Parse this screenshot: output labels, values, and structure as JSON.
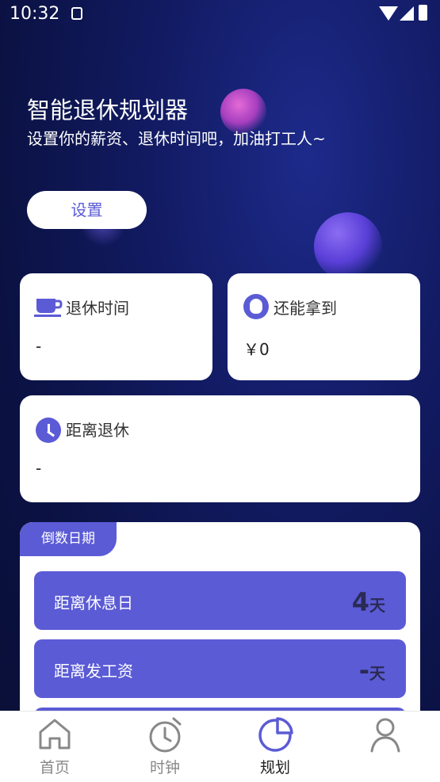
{
  "status_bar": {
    "time": "10:32"
  },
  "header": {
    "title": "智能退休规划器",
    "subtitle": "设置你的薪资、退休时间吧，加油打工人~",
    "settings_button": "设置"
  },
  "cards": {
    "retire_time": {
      "label": "退休时间",
      "value": "-",
      "icon": "coffee-cup-icon"
    },
    "still_get": {
      "label": "还能拿到",
      "value": "￥0",
      "icon": "money-bag-icon"
    },
    "until_retire": {
      "label": "距离退休",
      "value": "-",
      "icon": "clock-icon"
    }
  },
  "countdown": {
    "tag": "倒数日期",
    "items": [
      {
        "label": "距离休息日",
        "value": "4",
        "unit": "天"
      },
      {
        "label": "距离发工资",
        "value": "-",
        "unit": "天"
      }
    ]
  },
  "tabbar": {
    "active": "规划",
    "tabs": [
      {
        "label": "首页",
        "icon": "home-icon"
      },
      {
        "label": "时钟",
        "icon": "alarm-clock-icon"
      },
      {
        "label": "规划",
        "icon": "pie-chart-icon"
      },
      {
        "label": "",
        "icon": "user-icon"
      }
    ]
  },
  "colors": {
    "accent": "#5b5bd6",
    "background": "#121b63"
  }
}
